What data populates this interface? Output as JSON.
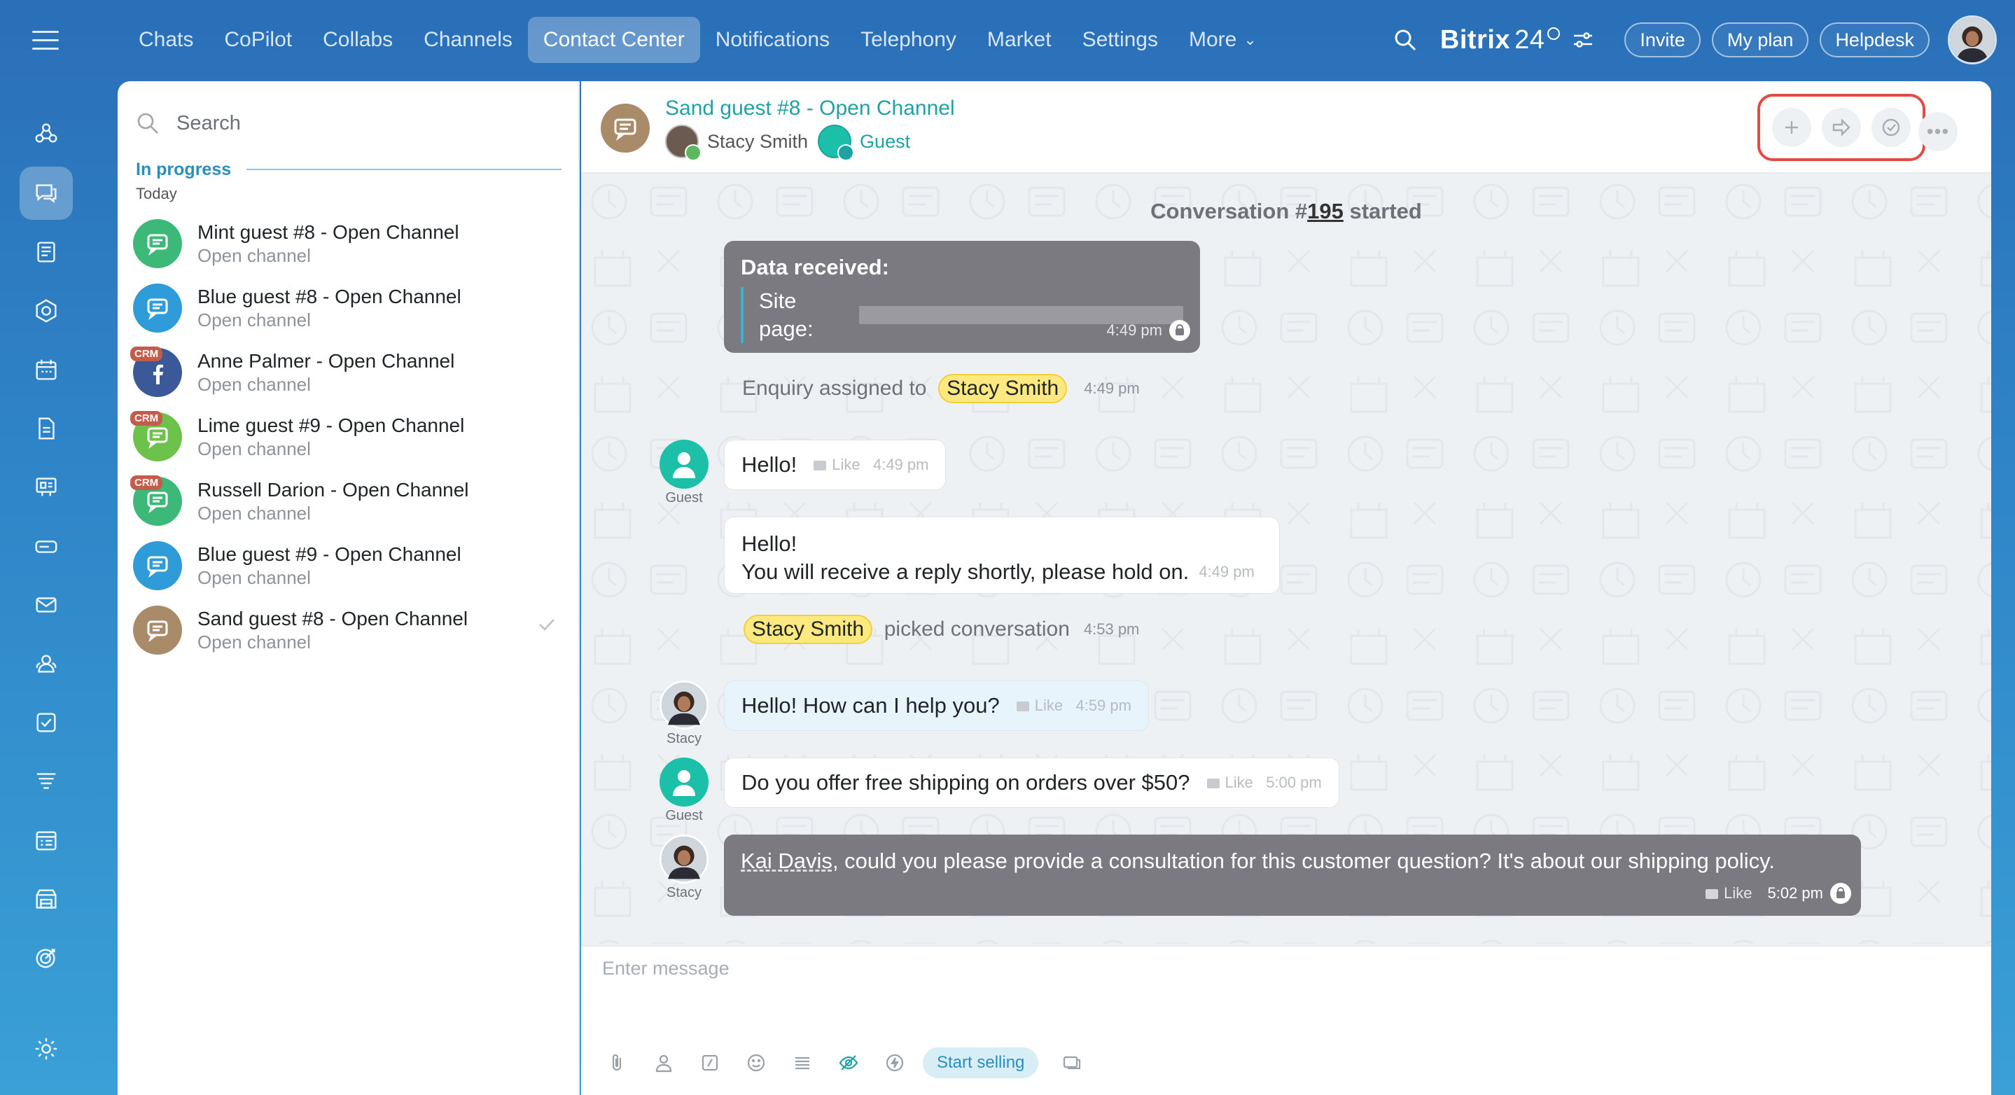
{
  "topnav": {
    "items": [
      "Chats",
      "CoPilot",
      "Collabs",
      "Channels",
      "Contact Center",
      "Notifications",
      "Telephony",
      "Market",
      "Settings",
      "More"
    ],
    "active": "Contact Center",
    "brand": "Bitrix",
    "brand_num": "24",
    "invite": "Invite",
    "myplan": "My plan",
    "helpdesk": "Helpdesk"
  },
  "sidebar": {
    "icons": [
      "menu-icon",
      "broadcast-icon",
      "chat-icon",
      "news-icon",
      "hexagon-icon",
      "calendar-icon",
      "document-icon",
      "presentation-icon",
      "drive-icon",
      "mail-icon",
      "people-icon",
      "tasks-icon",
      "funnel-icon",
      "schedule-icon",
      "store-icon",
      "target-icon",
      "settings-icon"
    ]
  },
  "list": {
    "search_placeholder": "Search",
    "section": "In progress",
    "group": "Today",
    "items": [
      {
        "title": "Mint guest #8 - Open Channel",
        "subtitle": "Open channel",
        "color": "#3cb878",
        "crm": ""
      },
      {
        "title": "Blue guest #8 - Open Channel",
        "subtitle": "Open channel",
        "color": "#2f9bd8",
        "crm": ""
      },
      {
        "title": "Anne Palmer - Open Channel",
        "subtitle": "Open channel",
        "color": "#3b5998",
        "crm": "CRM"
      },
      {
        "title": "Lime guest #9 - Open Channel",
        "subtitle": "Open channel",
        "color": "#6cc24a",
        "crm": "CRM"
      },
      {
        "title": "Russell Darion - Open Channel",
        "subtitle": "Open channel",
        "color": "#3cb878",
        "crm": "CRM"
      },
      {
        "title": "Blue guest #9 - Open Channel",
        "subtitle": "Open channel",
        "color": "#2f9bd8",
        "crm": ""
      },
      {
        "title": "Sand guest #8 - Open Channel",
        "subtitle": "Open channel",
        "color": "#a98b6a",
        "crm": ""
      }
    ]
  },
  "chat": {
    "title": "Sand guest #8 - Open Channel",
    "member1": "Stacy Smith",
    "member2": "Guest",
    "started_prefix": "Conversation #",
    "started_num": "195",
    "started_suffix": " started",
    "data_received": "Data received:",
    "site_page": "Site page:",
    "t_449": "4:49 pm",
    "enquiry_prefix": "Enquiry assigned to",
    "agent_tag": "Stacy Smith",
    "hello": "Hello!",
    "like": "Like",
    "auto_line1": "Hello!",
    "auto_line2": "You will receive a reply shortly, please hold on.",
    "picked": "picked conversation",
    "t_453": "4:53 pm",
    "stacy_msg": "Hello! How can I help you?",
    "t_459": "4:59 pm",
    "guest_msg": "Do you offer free shipping on orders over $50?",
    "t_500": "5:00 pm",
    "kai": "Kai Davis",
    "consult_msg": ", could you please provide a consultation for this customer question? It's about our shipping policy.",
    "t_502": "5:02 pm",
    "label_guest": "Guest",
    "label_stacy": "Stacy",
    "input_placeholder": "Enter message",
    "start_selling": "Start selling"
  }
}
